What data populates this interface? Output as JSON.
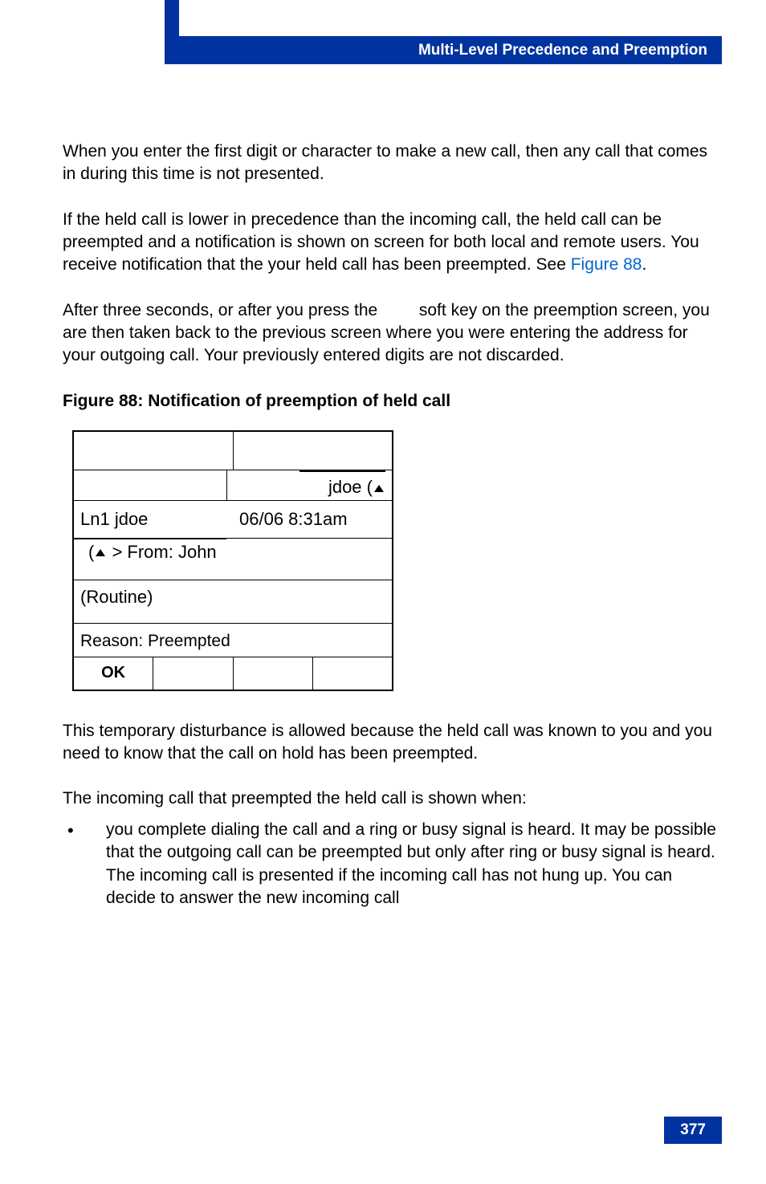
{
  "header": {
    "title": "Multi-Level Precedence and Preemption"
  },
  "paragraphs": {
    "p1": "When you enter the first digit or character to make a new call, then any call that comes in during this time is not presented.",
    "p2a": "If the held call is lower in precedence than the incoming call, the held call can be preempted and a notification is shown on screen for both local and remote users. You receive notification that the your held call has been preempted. See ",
    "p2link": "Figure 88",
    "p2b": ".",
    "p3a": "After three seconds, or after you press the ",
    "p3b": " soft key on the preemption screen, you are then taken back to the previous screen where you were entering the address for your outgoing call. Your previously entered digits are not discarded.",
    "p4": "This temporary disturbance is allowed because the held call was known to you and you need to know that the call on hold has been preempted.",
    "p5": "The incoming call that preempted the held call is shown when:",
    "bullet1": "you complete dialing the call and a ring or busy signal is heard. It may be possible that the outgoing call can be preempted but only after ring or busy signal is heard. The incoming call is presented if the incoming call has not hung up. You can decide to answer the new incoming call"
  },
  "figure": {
    "title": "Figure 88: Notification of preemption of held call"
  },
  "phone": {
    "topUser": "jdoe",
    "line": "Ln1 jdoe",
    "datetime": "06/06 8:31am",
    "from": "> From: John",
    "precedence": "(Routine)",
    "reason": "Reason: Preempted",
    "softkey1": "OK"
  },
  "pageNumber": "377"
}
